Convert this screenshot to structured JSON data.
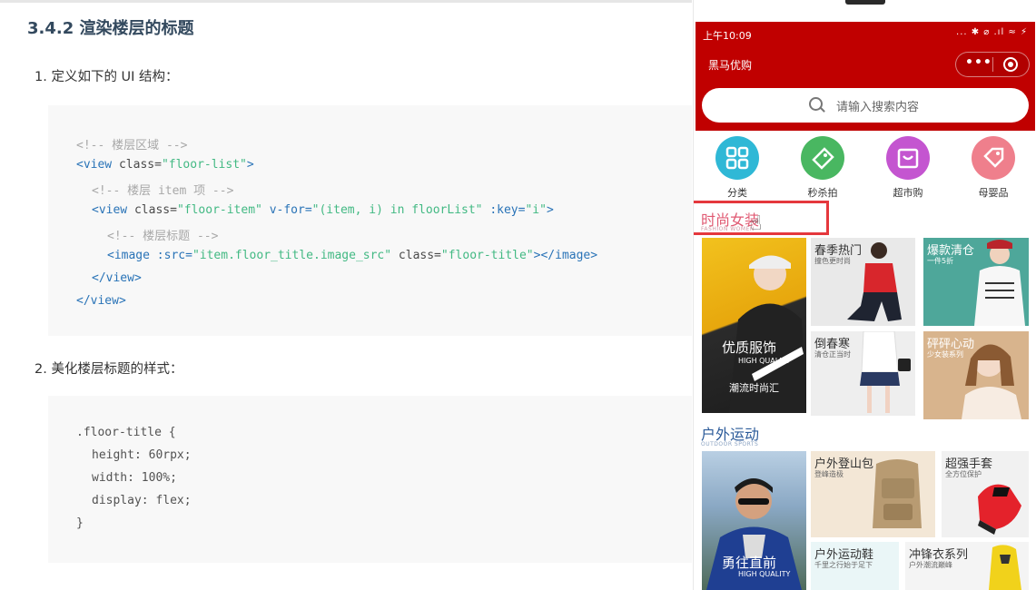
{
  "doc": {
    "heading": "3.4.2 渲染楼层的标题",
    "step1": "1. 定义如下的 UI 结构：",
    "code1": {
      "l1": "<!-- 楼层区域 -->",
      "l2_open": "<view",
      "l2_attr": "class=",
      "l2_val": "\"floor-list\"",
      "l2_close": ">",
      "l3": "<!-- 楼层 item 项 -->",
      "l4_open": "<view",
      "l4_a1": "class=",
      "l4_v1": "\"floor-item\"",
      "l4_a2": "v-for=",
      "l4_v2": "\"(item, i) in floorList\"",
      "l4_a3": ":key=",
      "l4_v3": "\"i\"",
      "l4_close": ">",
      "l5": "<!-- 楼层标题 -->",
      "l6_open": "<image",
      "l6_a1": ":src=",
      "l6_v1": "\"item.floor_title.image_src\"",
      "l6_a2": "class=",
      "l6_v2": "\"floor-title\"",
      "l6_close": "></image>",
      "l7": "</view>",
      "l8": "</view>"
    },
    "step2": "2. 美化楼层标题的样式：",
    "code2": {
      "l1": ".floor-title {",
      "l2": "height: 60rpx;",
      "l3": "width: 100%;",
      "l4": "display: flex;",
      "l5": "}"
    }
  },
  "phone": {
    "status_time": "上午10:09",
    "status_icons": "... ✱ ⌀ .ıl ≈ ⚡",
    "nav_title": "黑马优购",
    "capsule_dots": "•••",
    "search_placeholder": "请输入搜索内容",
    "navs": [
      {
        "label": "分类",
        "color": "#2fb8d6",
        "icon": "grid-icon"
      },
      {
        "label": "秒杀拍",
        "color": "#49b761",
        "icon": "tag-icon"
      },
      {
        "label": "超市购",
        "color": "#c455d0",
        "icon": "bag-icon"
      },
      {
        "label": "母婴品",
        "color": "#ef7f8c",
        "icon": "label-icon"
      }
    ],
    "floor1": {
      "title": "时尚女装",
      "subtitle": "FASHION WOMEN",
      "tiles": [
        {
          "label": "优质服饰",
          "sub": "HIGH QUALITY",
          "sub2": "潮流时尚汇"
        },
        {
          "label": "春季热门",
          "sub": "撞色更时尚"
        },
        {
          "label": "爆款清仓",
          "sub": "一件5折"
        },
        {
          "label": "倒春寒",
          "sub": "清仓正当时"
        },
        {
          "label": "砰砰心动",
          "sub": "少女装系列"
        }
      ]
    },
    "floor2": {
      "title": "户外运动",
      "subtitle": "OUTDOOR SPORTS",
      "tiles": [
        {
          "label": "勇往直前",
          "sub": "HIGH QUALITY"
        },
        {
          "label": "户外登山包",
          "sub": "登峰造极"
        },
        {
          "label": "超强手套",
          "sub": "全方位保护"
        },
        {
          "label": "户外运动鞋",
          "sub": "千里之行始于足下"
        },
        {
          "label": "冲锋衣系列",
          "sub": "户外潮流巅峰"
        }
      ]
    }
  }
}
